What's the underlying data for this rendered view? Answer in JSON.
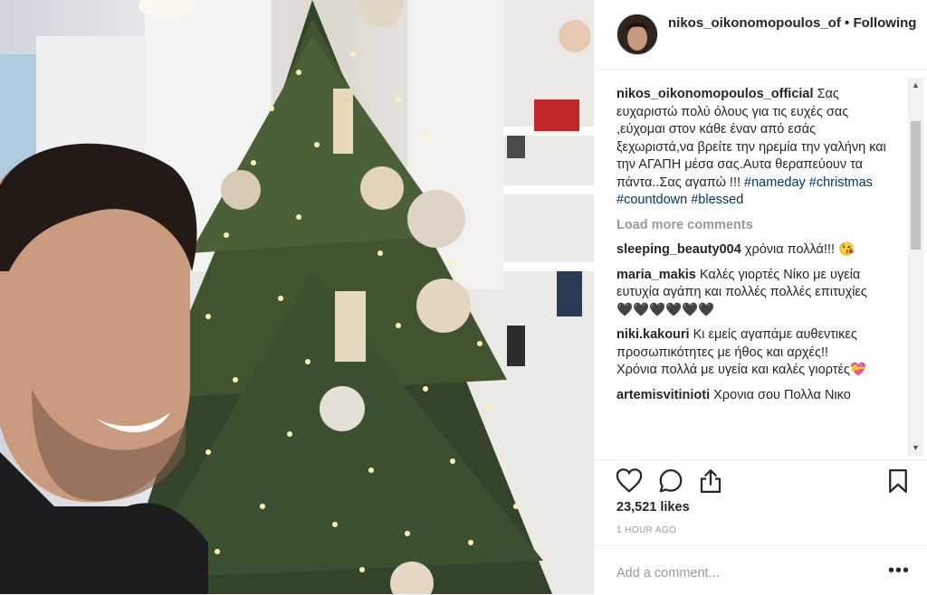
{
  "header": {
    "username": "nikos_oikonomopoulos_of",
    "separator": "•",
    "follow_status": "Following"
  },
  "caption": {
    "username": "nikos_oikonomopoulos_official",
    "text": "Σας ευχαριστώ πολύ όλους για τις ευχές σας ,εύχομαι στον κάθε έναν από εσάς ξεχωριστά,να βρείτε την ηρεμία την γαλήνη και την ΑΓΑΠΗ μέσα σας.Αυτα θεραπεύουν τα πάντα..Σας αγαπώ !!!",
    "hashtags": [
      "#nameday",
      "#christmas",
      "#countdown",
      "#blessed"
    ]
  },
  "load_more": "Load more comments",
  "comments": [
    {
      "user": "sleeping_beauty004",
      "text": "χρόνια πολλά!!! 😘"
    },
    {
      "user": "maria_makis",
      "text": "Καλές γιορτές Νίκο με υγεία ευτυχία αγάπη και πολλές πολλές επιτυχίες🖤🖤🖤🖤🖤🖤"
    },
    {
      "user": "niki.kakouri",
      "text": "Κι εμείς αγαπάμε αυθεντικες προσωπικότητες με ήθος και αρχές!! Χρόνια πολλά με υγεία και καλές γιορτές💝"
    },
    {
      "user": "artemisvitinioti",
      "text": "Χρονια σου Πολλα Νικο"
    }
  ],
  "likes": "23,521 likes",
  "time_ago": "1 HOUR AGO",
  "add_comment_placeholder": "Add a comment...",
  "more_label": "•••",
  "icons": {
    "like": "heart-icon",
    "comment": "comment-icon",
    "share": "share-icon",
    "save": "bookmark-icon"
  }
}
